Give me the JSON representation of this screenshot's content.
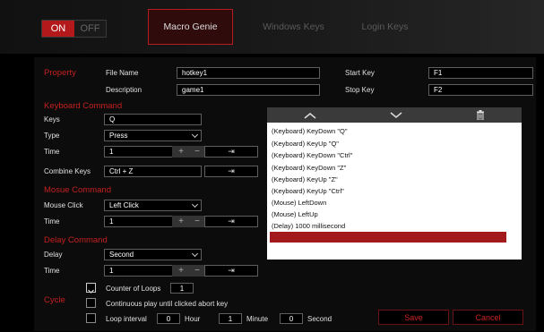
{
  "toggle": {
    "on": "ON",
    "off": "OFF"
  },
  "tabs": [
    "Macro Genie",
    "Windows Keys",
    "Login Keys"
  ],
  "property": {
    "title": "Property",
    "file_name_label": "File Name",
    "file_name": "hotkey1",
    "description_label": "Description",
    "description": "game1",
    "start_key_label": "Start Key",
    "start_key": "F1",
    "stop_key_label": "Stop Key",
    "stop_key": "F2"
  },
  "keyboard": {
    "title": "Keyboard Command",
    "keys_label": "Keys",
    "keys": "Q",
    "type_label": "Type",
    "type": "Press",
    "time_label": "Time",
    "time": "1",
    "combine_label": "Combine Keys",
    "combine": "Ctrl + Z"
  },
  "mouse": {
    "title": "Mosue Command",
    "click_label": "Mouse Click",
    "click": "Left Click",
    "time_label": "Time",
    "time": "1"
  },
  "delay": {
    "title": "Delay Command",
    "delay_label": "Delay",
    "delay": "Second",
    "time_label": "Time",
    "time": "1"
  },
  "cycle": {
    "title": "Cycle",
    "counter_label": "Counter of Loops",
    "counter": "1",
    "continuous_label": "Continuous play until clicked abort key",
    "interval_label": "Loop interval",
    "hour_value": "0",
    "hour_label": "Hour",
    "minute_value": "1",
    "minute_label": "Minute",
    "second_value": "0",
    "second_label": "Second"
  },
  "events": [
    "(Keyboard) KeyDown \"Q\"",
    "(Keyboard) KeyUp \"Q\"",
    "(Keyboard) KeyDown \"Ctrl\"",
    "(Keyboard) KeyDown \"Z\"",
    "(Keyboard) KeyUp \"Z\"",
    "(Keyboard) KeyUp \"Ctrl\"",
    "(Mouse) LeftDown",
    "(Mouse) LeftUp",
    "(Delay) 1000 millisecond"
  ],
  "buttons": {
    "save": "Save",
    "cancel": "Cancel"
  },
  "icons": {
    "plus": "+",
    "minus": "−",
    "enter": "⇥"
  },
  "colors": {
    "accent": "#b3191b",
    "panel": "#ffffff"
  }
}
